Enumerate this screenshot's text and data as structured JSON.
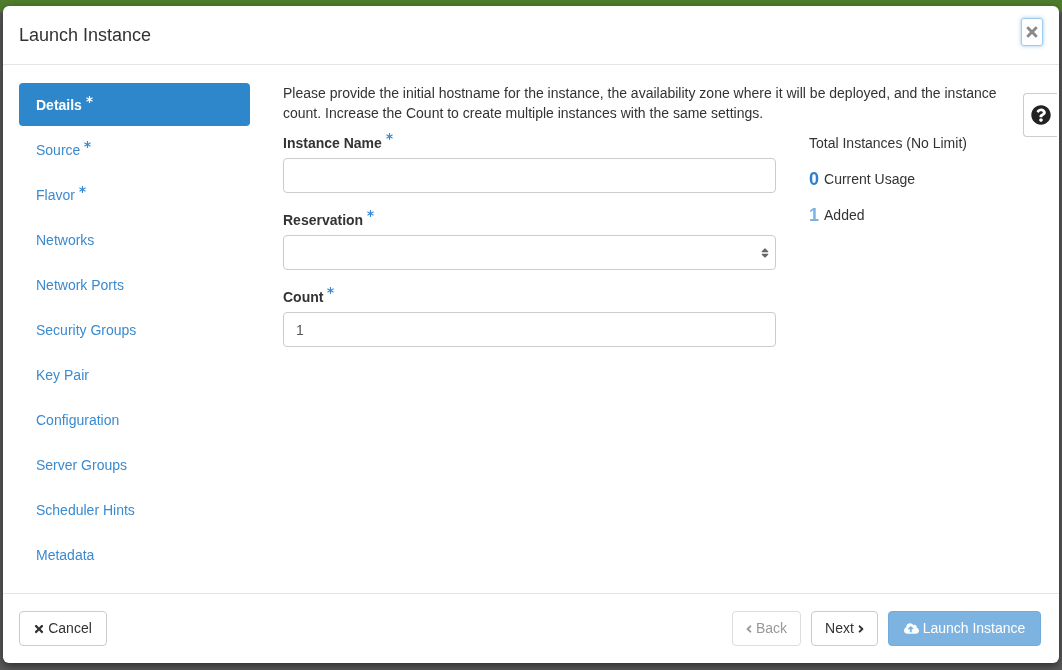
{
  "dialog": {
    "title": "Launch Instance"
  },
  "steps": [
    {
      "label": "Details",
      "required": true,
      "selected": true
    },
    {
      "label": "Source",
      "required": true,
      "selected": false
    },
    {
      "label": "Flavor",
      "required": true,
      "selected": false
    },
    {
      "label": "Networks",
      "required": false,
      "selected": false
    },
    {
      "label": "Network Ports",
      "required": false,
      "selected": false
    },
    {
      "label": "Security Groups",
      "required": false,
      "selected": false
    },
    {
      "label": "Key Pair",
      "required": false,
      "selected": false
    },
    {
      "label": "Configuration",
      "required": false,
      "selected": false
    },
    {
      "label": "Server Groups",
      "required": false,
      "selected": false
    },
    {
      "label": "Scheduler Hints",
      "required": false,
      "selected": false
    },
    {
      "label": "Metadata",
      "required": false,
      "selected": false
    }
  ],
  "help_text": "Please provide the initial hostname for the instance, the availability zone where it will be deployed, and the instance count. Increase the Count to create multiple instances with the same settings.",
  "fields": [
    {
      "label": "Instance Name",
      "required": true,
      "kind": "text"
    },
    {
      "label": "Reservation",
      "required": true,
      "kind": "select"
    },
    {
      "label": "Count",
      "required": true,
      "kind": "number",
      "value": "1"
    }
  ],
  "usage": {
    "title": "Total Instances (No Limit)",
    "items": [
      {
        "count": "0",
        "label": "Current Usage",
        "kind": "current"
      },
      {
        "count": "1",
        "label": "Added",
        "kind": "added"
      }
    ]
  },
  "footer": {
    "cancel": {
      "label": "Cancel"
    },
    "actions": [
      {
        "label": "Back",
        "kind": "back",
        "disabled": true
      },
      {
        "label": "Next",
        "kind": "next",
        "disabled": false
      },
      {
        "label": "Launch Instance",
        "kind": "launch",
        "disabled": true
      }
    ]
  }
}
